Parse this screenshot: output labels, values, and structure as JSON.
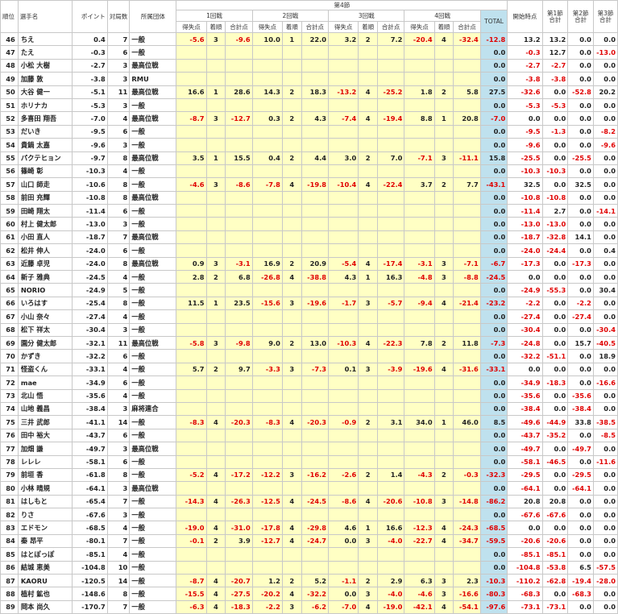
{
  "headers": {
    "rank": "順位",
    "name": "選手名",
    "points": "ポイント",
    "games": "対局数",
    "org": "所属団体",
    "section4": "第4節",
    "round1": "1回戦",
    "round2": "2回戦",
    "round3": "3回戦",
    "round4": "4回戦",
    "score": "得失点",
    "place": "着順",
    "total": "合計点",
    "total_col": "TOTAL",
    "start": "開始時点",
    "sec1": "第1節\n合計",
    "sec1_a": "第1節",
    "sec1_b": "合計",
    "sec2_a": "第2節",
    "sec2_b": "合計",
    "sec3_a": "第3節",
    "sec3_b": "合計"
  },
  "rows": [
    [
      "46",
      "ちえ",
      "0.4",
      "7",
      "一般",
      "-5.6",
      "3",
      "-9.6",
      "10.0",
      "1",
      "22.0",
      "3.2",
      "2",
      "7.2",
      "-20.4",
      "4",
      "-32.4",
      "-12.8",
      "13.2",
      "13.2",
      "0.0",
      "0.0"
    ],
    [
      "47",
      "たえ",
      "-0.3",
      "6",
      "一般",
      "",
      "",
      "",
      "",
      "",
      "",
      "",
      "",
      "",
      "",
      "",
      "",
      "0.0",
      "-0.3",
      "12.7",
      "0.0",
      "-13.0"
    ],
    [
      "48",
      "小松 大樹",
      "-2.7",
      "3",
      "最高位戦",
      "",
      "",
      "",
      "",
      "",
      "",
      "",
      "",
      "",
      "",
      "",
      "",
      "0.0",
      "-2.7",
      "-2.7",
      "0.0",
      "0.0"
    ],
    [
      "49",
      "加藤 敦",
      "-3.8",
      "3",
      "RMU",
      "",
      "",
      "",
      "",
      "",
      "",
      "",
      "",
      "",
      "",
      "",
      "",
      "0.0",
      "-3.8",
      "-3.8",
      "0.0",
      "0.0"
    ],
    [
      "50",
      "大谷 健一",
      "-5.1",
      "11",
      "最高位戦",
      "16.6",
      "1",
      "28.6",
      "14.3",
      "2",
      "18.3",
      "-13.2",
      "4",
      "-25.2",
      "1.8",
      "2",
      "5.8",
      "27.5",
      "-32.6",
      "0.0",
      "-52.8",
      "20.2"
    ],
    [
      "51",
      "ホリナカ",
      "-5.3",
      "3",
      "一般",
      "",
      "",
      "",
      "",
      "",
      "",
      "",
      "",
      "",
      "",
      "",
      "",
      "0.0",
      "-5.3",
      "-5.3",
      "0.0",
      "0.0"
    ],
    [
      "52",
      "多喜田 翔吾",
      "-7.0",
      "4",
      "最高位戦",
      "-8.7",
      "3",
      "-12.7",
      "0.3",
      "2",
      "4.3",
      "-7.4",
      "4",
      "-19.4",
      "8.8",
      "1",
      "20.8",
      "-7.0",
      "0.0",
      "0.0",
      "0.0",
      "0.0"
    ],
    [
      "53",
      "だいき",
      "-9.5",
      "6",
      "一般",
      "",
      "",
      "",
      "",
      "",
      "",
      "",
      "",
      "",
      "",
      "",
      "",
      "0.0",
      "-9.5",
      "-1.3",
      "0.0",
      "-8.2"
    ],
    [
      "54",
      "貴鍋 太嘉",
      "-9.6",
      "3",
      "一般",
      "",
      "",
      "",
      "",
      "",
      "",
      "",
      "",
      "",
      "",
      "",
      "",
      "0.0",
      "-9.6",
      "0.0",
      "0.0",
      "-9.6"
    ],
    [
      "55",
      "パクテヒョン",
      "-9.7",
      "8",
      "最高位戦",
      "3.5",
      "1",
      "15.5",
      "0.4",
      "2",
      "4.4",
      "3.0",
      "2",
      "7.0",
      "-7.1",
      "3",
      "-11.1",
      "15.8",
      "-25.5",
      "0.0",
      "-25.5",
      "0.0"
    ],
    [
      "56",
      "篠崎 彰",
      "-10.3",
      "4",
      "一般",
      "",
      "",
      "",
      "",
      "",
      "",
      "",
      "",
      "",
      "",
      "",
      "",
      "0.0",
      "-10.3",
      "-10.3",
      "0.0",
      "0.0"
    ],
    [
      "57",
      "山口 師走",
      "-10.6",
      "8",
      "一般",
      "-4.6",
      "3",
      "-8.6",
      "-7.8",
      "4",
      "-19.8",
      "-10.4",
      "4",
      "-22.4",
      "3.7",
      "2",
      "7.7",
      "-43.1",
      "32.5",
      "0.0",
      "32.5",
      "0.0"
    ],
    [
      "58",
      "前田 充輝",
      "-10.8",
      "8",
      "最高位戦",
      "",
      "",
      "",
      "",
      "",
      "",
      "",
      "",
      "",
      "",
      "",
      "",
      "0.0",
      "-10.8",
      "-10.8",
      "0.0",
      "0.0"
    ],
    [
      "59",
      "田崎 翔太",
      "-11.4",
      "6",
      "一般",
      "",
      "",
      "",
      "",
      "",
      "",
      "",
      "",
      "",
      "",
      "",
      "",
      "0.0",
      "-11.4",
      "2.7",
      "0.0",
      "-14.1"
    ],
    [
      "60",
      "村上 健太郎",
      "-13.0",
      "3",
      "一般",
      "",
      "",
      "",
      "",
      "",
      "",
      "",
      "",
      "",
      "",
      "",
      "",
      "0.0",
      "-13.0",
      "-13.0",
      "0.0",
      "0.0"
    ],
    [
      "61",
      "小田 直人",
      "-18.7",
      "7",
      "最高位戦",
      "",
      "",
      "",
      "",
      "",
      "",
      "",
      "",
      "",
      "",
      "",
      "",
      "0.0",
      "-18.7",
      "-32.8",
      "14.1",
      "0.0"
    ],
    [
      "62",
      "松井 伸人",
      "-24.0",
      "6",
      "一般",
      "",
      "",
      "",
      "",
      "",
      "",
      "",
      "",
      "",
      "",
      "",
      "",
      "0.0",
      "-24.0",
      "-24.4",
      "0.0",
      "0.4"
    ],
    [
      "63",
      "近藤 卓児",
      "-24.0",
      "8",
      "最高位戦",
      "0.9",
      "3",
      "-3.1",
      "16.9",
      "2",
      "20.9",
      "-5.4",
      "4",
      "-17.4",
      "-3.1",
      "3",
      "-7.1",
      "-6.7",
      "-17.3",
      "0.0",
      "-17.3",
      "0.0"
    ],
    [
      "64",
      "新子 雅典",
      "-24.5",
      "4",
      "一般",
      "2.8",
      "2",
      "6.8",
      "-26.8",
      "4",
      "-38.8",
      "4.3",
      "1",
      "16.3",
      "-4.8",
      "3",
      "-8.8",
      "-24.5",
      "0.0",
      "0.0",
      "0.0",
      "0.0"
    ],
    [
      "65",
      "NORIO",
      "-24.9",
      "5",
      "一般",
      "",
      "",
      "",
      "",
      "",
      "",
      "",
      "",
      "",
      "",
      "",
      "",
      "0.0",
      "-24.9",
      "-55.3",
      "0.0",
      "30.4"
    ],
    [
      "66",
      "いろはす",
      "-25.4",
      "8",
      "一般",
      "11.5",
      "1",
      "23.5",
      "-15.6",
      "3",
      "-19.6",
      "-1.7",
      "3",
      "-5.7",
      "-9.4",
      "4",
      "-21.4",
      "-23.2",
      "-2.2",
      "0.0",
      "-2.2",
      "0.0"
    ],
    [
      "67",
      "小山 奈々",
      "-27.4",
      "4",
      "一般",
      "",
      "",
      "",
      "",
      "",
      "",
      "",
      "",
      "",
      "",
      "",
      "",
      "0.0",
      "-27.4",
      "0.0",
      "-27.4",
      "0.0"
    ],
    [
      "68",
      "松下 祥太",
      "-30.4",
      "3",
      "一般",
      "",
      "",
      "",
      "",
      "",
      "",
      "",
      "",
      "",
      "",
      "",
      "",
      "0.0",
      "-30.4",
      "0.0",
      "0.0",
      "-30.4"
    ],
    [
      "69",
      "園分 健太郎",
      "-32.1",
      "11",
      "最高位戦",
      "-5.8",
      "3",
      "-9.8",
      "9.0",
      "2",
      "13.0",
      "-10.3",
      "4",
      "-22.3",
      "7.8",
      "2",
      "11.8",
      "-7.3",
      "-24.8",
      "0.0",
      "15.7",
      "-40.5"
    ],
    [
      "70",
      "かずき",
      "-32.2",
      "6",
      "一般",
      "",
      "",
      "",
      "",
      "",
      "",
      "",
      "",
      "",
      "",
      "",
      "",
      "0.0",
      "-32.2",
      "-51.1",
      "0.0",
      "18.9"
    ],
    [
      "71",
      "怪盗くん",
      "-33.1",
      "4",
      "一般",
      "5.7",
      "2",
      "9.7",
      "-3.3",
      "3",
      "-7.3",
      "0.1",
      "3",
      "-3.9",
      "-19.6",
      "4",
      "-31.6",
      "-33.1",
      "0.0",
      "0.0",
      "0.0",
      "0.0"
    ],
    [
      "72",
      "mae",
      "-34.9",
      "6",
      "一般",
      "",
      "",
      "",
      "",
      "",
      "",
      "",
      "",
      "",
      "",
      "",
      "",
      "0.0",
      "-34.9",
      "-18.3",
      "0.0",
      "-16.6"
    ],
    [
      "73",
      "北山 悟",
      "-35.6",
      "4",
      "一般",
      "",
      "",
      "",
      "",
      "",
      "",
      "",
      "",
      "",
      "",
      "",
      "",
      "0.0",
      "-35.6",
      "0.0",
      "-35.6",
      "0.0"
    ],
    [
      "74",
      "山地 義昌",
      "-38.4",
      "3",
      "麻将連合",
      "",
      "",
      "",
      "",
      "",
      "",
      "",
      "",
      "",
      "",
      "",
      "",
      "0.0",
      "-38.4",
      "0.0",
      "-38.4",
      "0.0"
    ],
    [
      "75",
      "三井 武郎",
      "-41.1",
      "14",
      "一般",
      "-8.3",
      "4",
      "-20.3",
      "-8.3",
      "4",
      "-20.3",
      "-0.9",
      "2",
      "3.1",
      "34.0",
      "1",
      "46.0",
      "8.5",
      "-49.6",
      "-44.9",
      "33.8",
      "-38.5"
    ],
    [
      "76",
      "田中 裕大",
      "-43.7",
      "6",
      "一般",
      "",
      "",
      "",
      "",
      "",
      "",
      "",
      "",
      "",
      "",
      "",
      "",
      "0.0",
      "-43.7",
      "-35.2",
      "0.0",
      "-8.5"
    ],
    [
      "77",
      "加畑 謙",
      "-49.7",
      "3",
      "最高位戦",
      "",
      "",
      "",
      "",
      "",
      "",
      "",
      "",
      "",
      "",
      "",
      "",
      "0.0",
      "-49.7",
      "0.0",
      "-49.7",
      "0.0"
    ],
    [
      "78",
      "レレレ",
      "-58.1",
      "6",
      "一般",
      "",
      "",
      "",
      "",
      "",
      "",
      "",
      "",
      "",
      "",
      "",
      "",
      "0.0",
      "-58.1",
      "-46.5",
      "0.0",
      "-11.6"
    ],
    [
      "79",
      "前垣 香",
      "-61.8",
      "8",
      "一般",
      "-5.2",
      "4",
      "-17.2",
      "-12.2",
      "3",
      "-16.2",
      "-2.6",
      "2",
      "1.4",
      "-4.3",
      "2",
      "-0.3",
      "-32.3",
      "-29.5",
      "0.0",
      "-29.5",
      "0.0"
    ],
    [
      "80",
      "小林 晴規",
      "-64.1",
      "3",
      "最高位戦",
      "",
      "",
      "",
      "",
      "",
      "",
      "",
      "",
      "",
      "",
      "",
      "",
      "0.0",
      "-64.1",
      "0.0",
      "-64.1",
      "0.0"
    ],
    [
      "81",
      "はしもと",
      "-65.4",
      "7",
      "一般",
      "-14.3",
      "4",
      "-26.3",
      "-12.5",
      "4",
      "-24.5",
      "-8.6",
      "4",
      "-20.6",
      "-10.8",
      "3",
      "-14.8",
      "-86.2",
      "20.8",
      "20.8",
      "0.0",
      "0.0"
    ],
    [
      "82",
      "りさ",
      "-67.6",
      "3",
      "一般",
      "",
      "",
      "",
      "",
      "",
      "",
      "",
      "",
      "",
      "",
      "",
      "",
      "0.0",
      "-67.6",
      "-67.6",
      "0.0",
      "0.0"
    ],
    [
      "83",
      "エドモン",
      "-68.5",
      "4",
      "一般",
      "-19.0",
      "4",
      "-31.0",
      "-17.8",
      "4",
      "-29.8",
      "4.6",
      "1",
      "16.6",
      "-12.3",
      "4",
      "-24.3",
      "-68.5",
      "0.0",
      "0.0",
      "0.0",
      "0.0"
    ],
    [
      "84",
      "秦 昂平",
      "-80.1",
      "7",
      "一般",
      "-0.1",
      "2",
      "3.9",
      "-12.7",
      "4",
      "-24.7",
      "0.0",
      "3",
      "-4.0",
      "-22.7",
      "4",
      "-34.7",
      "-59.5",
      "-20.6",
      "-20.6",
      "0.0",
      "0.0"
    ],
    [
      "85",
      "はとぽっぽ",
      "-85.1",
      "4",
      "一般",
      "",
      "",
      "",
      "",
      "",
      "",
      "",
      "",
      "",
      "",
      "",
      "",
      "0.0",
      "-85.1",
      "-85.1",
      "0.0",
      "0.0"
    ],
    [
      "86",
      "結城 恵美",
      "-104.8",
      "10",
      "一般",
      "",
      "",
      "",
      "",
      "",
      "",
      "",
      "",
      "",
      "",
      "",
      "",
      "0.0",
      "-104.8",
      "-53.8",
      "6.5",
      "-57.5"
    ],
    [
      "87",
      "KAORU",
      "-120.5",
      "14",
      "一般",
      "-8.7",
      "4",
      "-20.7",
      "1.2",
      "2",
      "5.2",
      "-1.1",
      "2",
      "2.9",
      "6.3",
      "3",
      "2.3",
      "-10.3",
      "-110.2",
      "-62.8",
      "-19.4",
      "-28.0"
    ],
    [
      "88",
      "植村 鉱也",
      "-148.6",
      "8",
      "一般",
      "-15.5",
      "4",
      "-27.5",
      "-20.2",
      "4",
      "-32.2",
      "0.0",
      "3",
      "-4.0",
      "-4.6",
      "3",
      "-16.6",
      "-80.3",
      "-68.3",
      "0.0",
      "-68.3",
      "0.0"
    ],
    [
      "89",
      "岡本 尚久",
      "-170.7",
      "7",
      "一般",
      "-6.3",
      "4",
      "-18.3",
      "-2.2",
      "3",
      "-6.2",
      "-7.0",
      "4",
      "-19.0",
      "-42.1",
      "4",
      "-54.1",
      "-97.6",
      "-73.1",
      "-73.1",
      "0.0",
      "0.0"
    ]
  ]
}
